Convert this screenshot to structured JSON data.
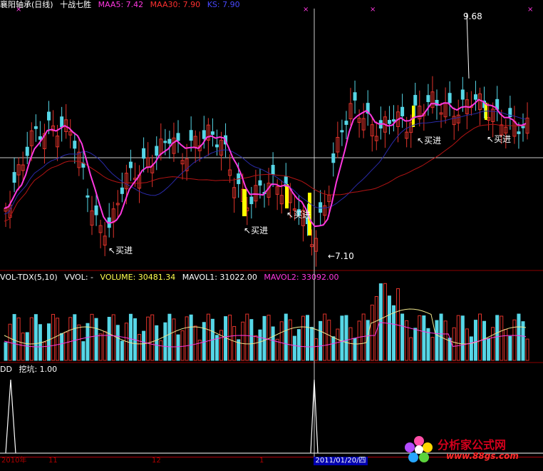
{
  "main_panel": {
    "title": "襄阳轴承(日线)",
    "indicator_name": "十战七胜",
    "ma5_label": "MAA5: 7.42",
    "ma30_label": "MAA30: 7.90",
    "ks_label": "KS: 7.90",
    "peak_label": "9.68",
    "low_label": "7.10",
    "buy_label": "买进"
  },
  "volume_panel": {
    "title": "VOL-TDX(5,10)",
    "vvol": "VVOL: -",
    "volume": "VOLUME: 30481.34",
    "mavol1": "MAVOL1: 31022.00",
    "mavol2": "MAVOL2: 33092.00"
  },
  "dd_panel": {
    "title": "DD",
    "value": "挖坑: 1.00"
  },
  "axis": {
    "t_2010": "2010年",
    "t_11": "11",
    "t_12": "12",
    "t_1": "1",
    "cursor_date": "2011/01/20/四"
  },
  "watermark": {
    "title": "分析家公式网",
    "url": "www.88gs.com"
  },
  "colors": {
    "up": "#e1332b",
    "down": "#56d6e6",
    "signal": "#ffff00",
    "ma5": "#ff38e0",
    "ma30": "#b41414",
    "ks": "#2a2aa8",
    "grid": "#8c0000"
  }
}
